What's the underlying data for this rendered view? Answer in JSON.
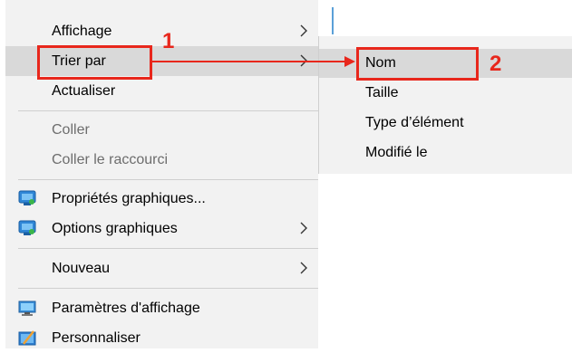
{
  "context_menu": {
    "items": [
      {
        "label": "Affichage"
      },
      {
        "label": "Trier par"
      },
      {
        "label": "Actualiser"
      },
      {
        "label": "Coller"
      },
      {
        "label": "Coller le raccourci"
      },
      {
        "label": "Propriétés graphiques..."
      },
      {
        "label": "Options graphiques"
      },
      {
        "label": "Nouveau"
      },
      {
        "label": "Paramètres d'affichage"
      },
      {
        "label": "Personnaliser"
      }
    ]
  },
  "submenu": {
    "items": [
      {
        "label": "Nom"
      },
      {
        "label": "Taille"
      },
      {
        "label": "Type d’élément"
      },
      {
        "label": "Modifié le"
      }
    ]
  },
  "annotations": {
    "step1": "1",
    "step2": "2",
    "color": "#e8271c"
  },
  "icons": {
    "graphics_properties": "intel-graphics-icon",
    "graphics_options": "intel-graphics-icon",
    "display_settings": "monitor-icon",
    "personalize": "personalize-icon"
  }
}
